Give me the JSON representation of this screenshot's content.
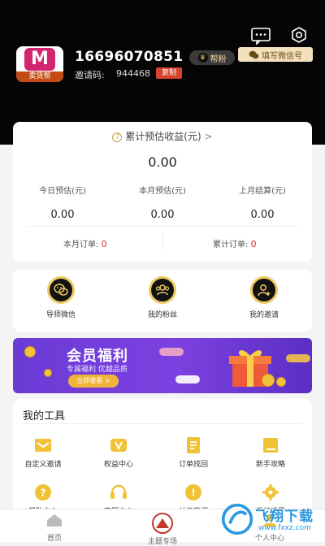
{
  "header": {
    "user_phone": "16696070851",
    "help_badge": "帮粉",
    "wechat_fill": "填写微信号",
    "invite_label": "邀请码:",
    "invite_code": "944468",
    "copy_label": "复制",
    "avatar_text": "卖货帮",
    "avatar_logo": "M"
  },
  "earnings": {
    "title": "累计预估收益(元)",
    "total": "0.00",
    "stats": [
      {
        "label": "今日预估(元)",
        "value": "0.00"
      },
      {
        "label": "本月预估(元)",
        "value": "0.00"
      },
      {
        "label": "上月结算(元)",
        "value": "0.00"
      }
    ],
    "month_orders_label": "本月订单:",
    "month_orders_value": "0",
    "total_orders_label": "累计订单:",
    "total_orders_value": "0"
  },
  "actions": [
    {
      "label": "导师微信",
      "icon": "wechat-icon"
    },
    {
      "label": "我的粉丝",
      "icon": "fans-icon"
    },
    {
      "label": "我的邀请",
      "icon": "invite-user-icon"
    }
  ],
  "banner": {
    "title": "会员福利",
    "subtitle": "专属福利 优越品质",
    "button": "立即查看 >"
  },
  "tools": {
    "title": "我的工具",
    "items": [
      {
        "label": "自定义邀请",
        "icon": "envelope-icon"
      },
      {
        "label": "权益中心",
        "icon": "vip-icon"
      },
      {
        "label": "订单找回",
        "icon": "document-icon"
      },
      {
        "label": "新手攻略",
        "icon": "book-icon"
      },
      {
        "label": "帮助中心",
        "icon": "help-icon"
      },
      {
        "label": "客服中心",
        "icon": "headset-icon"
      },
      {
        "label": "关于我们",
        "icon": "info-icon"
      },
      {
        "label": "系统设置",
        "icon": "settings-icon"
      }
    ]
  },
  "tabbar": {
    "items": [
      {
        "label": "首页",
        "icon": "home-icon"
      },
      {
        "label": "主题专场",
        "icon": "theme-icon"
      },
      {
        "label": "个人中心",
        "icon": "profile-icon"
      }
    ]
  },
  "watermark": {
    "text": "飞翔下载",
    "url": "www.fxxz.com"
  },
  "colors": {
    "header_bg": "#050505",
    "accent_gold": "#f0c962",
    "banner_purple": "#7c41e0",
    "order_red": "#e02f2f"
  }
}
